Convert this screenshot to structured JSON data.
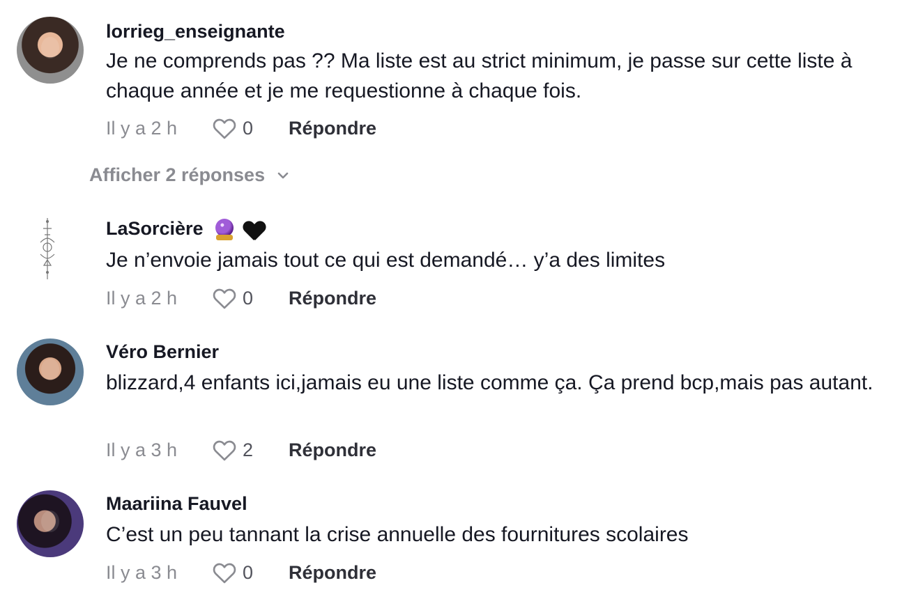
{
  "comments": [
    {
      "username": "lorrieg_enseignante",
      "text": "Je ne comprends pas ?? Ma liste est au strict minimum, je passe sur cette liste à chaque année et je me requestionne à chaque fois.",
      "time": "Il y a 2 h",
      "likes": "0",
      "reply": "Répondre"
    },
    {
      "username": "LaSorcière",
      "text": "Je n’envoie jamais tout ce qui est demandé… y’a des limites",
      "time": "Il y a 2 h",
      "likes": "0",
      "reply": "Répondre"
    },
    {
      "username": "Véro Bernier",
      "text": "blizzard,4 enfants ici,jamais eu une liste comme ça. Ça prend bcp,mais pas autant.",
      "time": "Il y a 3 h",
      "likes": "2",
      "reply": "Répondre"
    },
    {
      "username": "Maariina Fauvel",
      "text": "C’est un peu tannant la crise annuelle des fournitures scolaires",
      "time": "Il y a 3 h",
      "likes": "0",
      "reply": "Répondre"
    }
  ],
  "show_replies": "Afficher 2 réponses",
  "icons": {
    "like": "heart-outline-icon",
    "expand": "chevron-down-icon"
  },
  "colors": {
    "text": "#161823",
    "muted": "#8a8b91",
    "secondary": "#52535c"
  }
}
